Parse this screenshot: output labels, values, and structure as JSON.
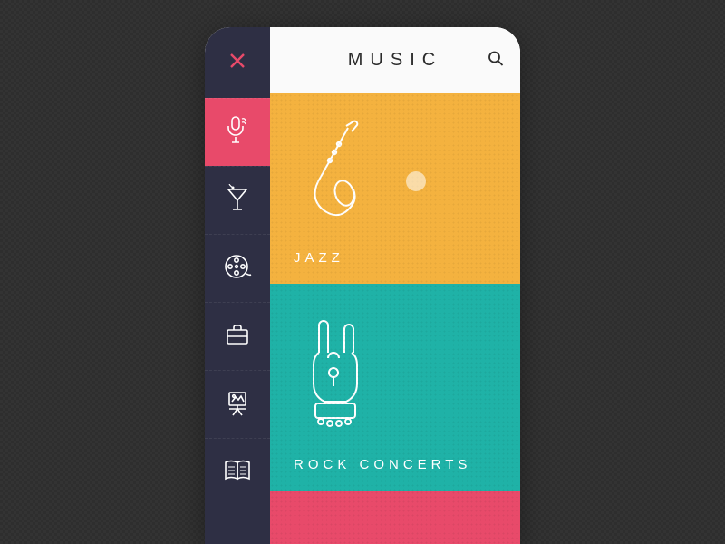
{
  "header": {
    "title": "MUSIC",
    "search_icon": "search-icon"
  },
  "sidebar": {
    "items": [
      {
        "name": "close",
        "icon": "close-icon",
        "active": false
      },
      {
        "name": "music",
        "icon": "microphone-icon",
        "active": true
      },
      {
        "name": "nightlife",
        "icon": "cocktail-icon",
        "active": false
      },
      {
        "name": "film",
        "icon": "film-reel-icon",
        "active": false
      },
      {
        "name": "business",
        "icon": "briefcase-icon",
        "active": false
      },
      {
        "name": "art",
        "icon": "easel-icon",
        "active": false
      },
      {
        "name": "reading",
        "icon": "book-icon",
        "active": false
      }
    ]
  },
  "categories": [
    {
      "label": "JAZZ",
      "icon": "saxophone-icon",
      "color": "#f4b23f"
    },
    {
      "label": "ROCK CONCERTS",
      "icon": "rock-hand-icon",
      "color": "#1fb2a7"
    }
  ],
  "colors": {
    "accent": "#e84a6a",
    "sidebar_bg": "#2e2f44",
    "jazz": "#f4b23f",
    "rock": "#1fb2a7"
  }
}
